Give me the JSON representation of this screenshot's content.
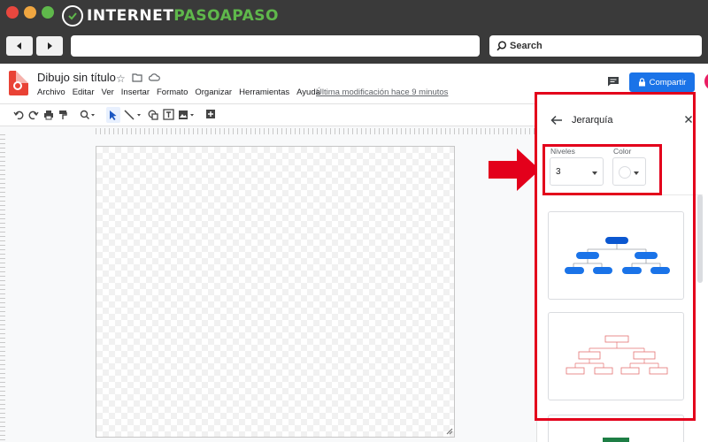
{
  "browser": {
    "brand_left": "INTERNET",
    "brand_right": "PASOAPASO",
    "search_label": "Search"
  },
  "doc": {
    "title": "Dibujo sin título",
    "menu": [
      "Archivo",
      "Editar",
      "Ver",
      "Insertar",
      "Formato",
      "Organizar",
      "Herramientas",
      "Ayuda"
    ],
    "last_modified": "Última modificación hace 9 minutos",
    "share_label": "Compartir"
  },
  "colors": {
    "accent": "#1a73e8",
    "highlight": "#e3001b",
    "chart_dark_blue": "#0b57d0",
    "chart_mid_blue": "#1a73e8",
    "chart_red": "#e57373"
  },
  "panel": {
    "title": "Jerarquía",
    "levels_label": "Niveles",
    "levels_value": "3",
    "color_label": "Color"
  },
  "icons": [
    "back-icon",
    "forward-icon",
    "search-icon",
    "star-icon",
    "folder-icon",
    "cloud-icon",
    "comment-icon",
    "lock-icon",
    "undo-icon",
    "redo-icon",
    "print-icon",
    "paint-format-icon",
    "zoom-icon",
    "select-icon",
    "line-icon",
    "shape-icon",
    "textbox-icon",
    "image-icon",
    "add-icon",
    "close-icon"
  ]
}
